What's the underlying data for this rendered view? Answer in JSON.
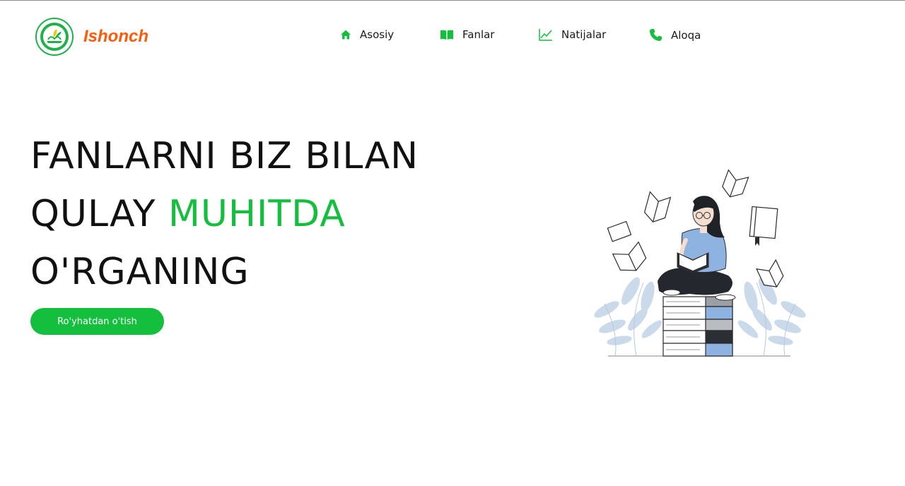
{
  "header": {
    "logo": {
      "ring_text_top": "ISHONCH",
      "ring_text_bottom": "O'QUV MARKAZI"
    },
    "brand": "Ishonch",
    "nav": [
      {
        "label": "Asosiy",
        "icon": "home-icon"
      },
      {
        "label": "Fanlar",
        "icon": "book-icon"
      },
      {
        "label": "Natijalar",
        "icon": "chart-line-icon"
      },
      {
        "label": "Aloqa",
        "icon": "phone-icon"
      }
    ]
  },
  "hero": {
    "line1": "FANLARNI BIZ BILAN",
    "line2_plain": "QULAY ",
    "line2_accent": "MUHITDA",
    "line3": "O'RGANING",
    "cta_label": "Ro'yhatdan o'tish"
  },
  "colors": {
    "accent_green": "#13bf3c",
    "brand_orange": "#ff5a0a",
    "text": "#111111"
  }
}
